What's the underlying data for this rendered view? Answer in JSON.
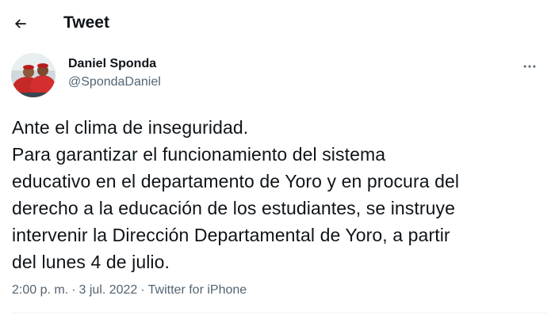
{
  "header": {
    "title": "Tweet"
  },
  "author": {
    "display_name": "Daniel Sponda",
    "handle": "@SpondaDaniel"
  },
  "tweet": {
    "lines": [
      "Ante el clima de inseguridad.",
      "Para garantizar el funcionamiento del sistema",
      "educativo en el departamento de Yoro y en procura del",
      "derecho a la educación de los estudiantes, se instruye",
      "intervenir la Dirección Departamental de Yoro, a partir",
      "del lunes 4 de julio."
    ]
  },
  "meta": {
    "time": "2:00 p. m.",
    "separator": "·",
    "date": "3 jul. 2022",
    "source": "Twitter for iPhone"
  },
  "icons": {
    "back": "arrow-left-icon",
    "more": "more-horizontal-icon"
  },
  "colors": {
    "text": "#0f1419",
    "secondary": "#536471",
    "divider": "#eff3f4"
  }
}
